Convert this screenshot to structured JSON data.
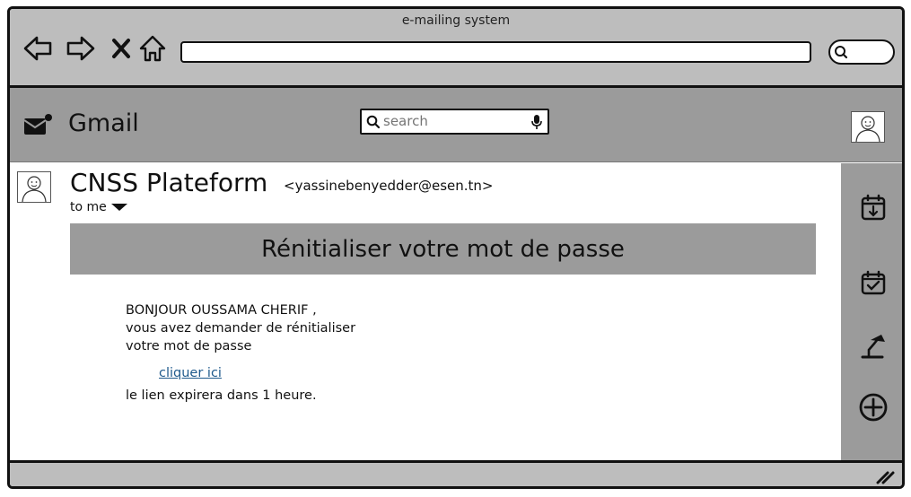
{
  "window": {
    "title": "e-mailing system"
  },
  "browser": {
    "nav_icons": [
      "back-arrow-icon",
      "forward-arrow-icon",
      "close-x-icon",
      "home-icon"
    ],
    "url_value": "",
    "search_icon": "search-icon"
  },
  "appbar": {
    "app_name": "Gmail",
    "search_placeholder": "search",
    "icons": [
      "mail-notification-icon",
      "search-icon",
      "microphone-icon",
      "user-avatar-icon"
    ]
  },
  "email": {
    "sender_name": "CNSS Plateform",
    "sender_email": "<yassinebenyedder@esen.tn>",
    "recipient_label": "to me",
    "banner_title": "Rénitialiser votre mot de passe",
    "body_lines": [
      "BONJOUR OUSSAMA CHERIF ,",
      "vous avez demander de rénitialiser",
      "votre mot de passe"
    ],
    "link_text": "cliquer ici",
    "footer_text": "le lien expirera dans 1 heure."
  },
  "right_sidebar": {
    "icons": [
      "calendar-download-icon",
      "calendar-check-icon",
      "lamp-icon",
      "add-circle-icon"
    ]
  },
  "colors": {
    "chrome": "#bdbdbd",
    "bar": "#9b9b9b",
    "link": "#1f5a8c"
  }
}
